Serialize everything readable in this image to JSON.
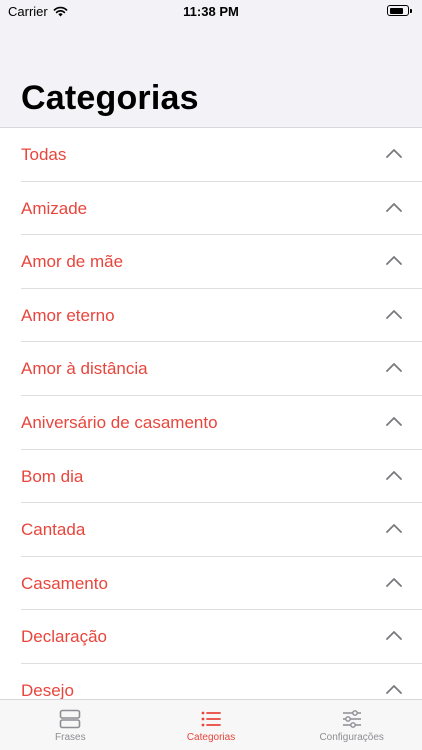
{
  "status_bar": {
    "carrier": "Carrier",
    "time": "11:38 PM",
    "battery_level": 0.8
  },
  "title": "Categorias",
  "categories": [
    "Todas",
    "Amizade",
    "Amor de mãe",
    "Amor eterno",
    "Amor à distância",
    "Aniversário de casamento",
    "Bom dia",
    "Cantada",
    "Casamento",
    "Declaração",
    "Desejo"
  ],
  "row_icon": "chevron-up-icon",
  "tabs": [
    {
      "label": "Frases",
      "icon": "list-cards-icon",
      "active": false
    },
    {
      "label": "Categorias",
      "icon": "bullet-list-icon",
      "active": true
    },
    {
      "label": "Configurações",
      "icon": "sliders-icon",
      "active": false
    }
  ],
  "colors": {
    "accent": "#e8453c",
    "inactive": "#8e8e93",
    "background": "#f2f2f7"
  }
}
